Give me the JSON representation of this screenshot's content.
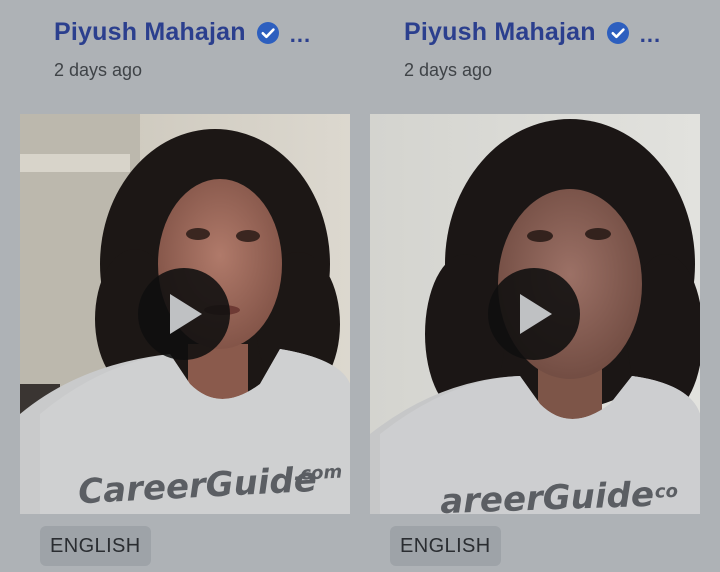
{
  "posts": [
    {
      "author": {
        "name": "Piyush Mahajan",
        "verified": true,
        "more_label": "..."
      },
      "time_ago": "2 days ago",
      "video": {
        "shirt_brand": "CareerGuide",
        "shirt_brand_suffix": ".com",
        "play_icon": "play-icon"
      },
      "language": "ENGLISH"
    },
    {
      "author": {
        "name": "Piyush Mahajan",
        "verified": true,
        "more_label": "..."
      },
      "time_ago": "2 days ago",
      "video": {
        "shirt_brand": "areerGuide",
        "shirt_brand_suffix": ".co",
        "play_icon": "play-icon"
      },
      "language": "ENGLISH"
    }
  ],
  "colors": {
    "author_name": "#2b3f8e",
    "verified_badge": "#2d5fbf",
    "background": "#aeb2b6",
    "chip_background": "#9ea3a8"
  }
}
